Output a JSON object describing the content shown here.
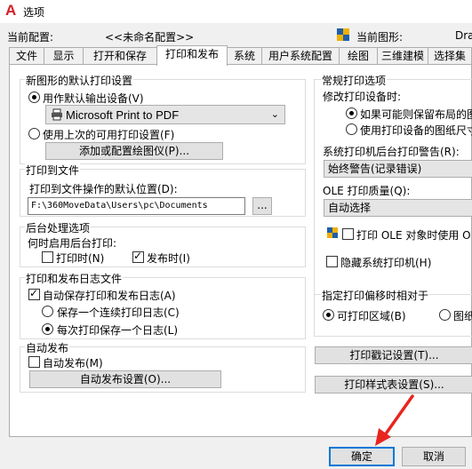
{
  "window": {
    "title": "选项"
  },
  "config": {
    "current_profile_label": "当前配置:",
    "current_profile_value": "<<未命名配置>>",
    "current_drawing_label": "当前图形:",
    "current_drawing_value": "Dra"
  },
  "tabs": [
    {
      "label": "文件"
    },
    {
      "label": "显示"
    },
    {
      "label": "打开和保存"
    },
    {
      "label": "打印和发布",
      "active": true
    },
    {
      "label": "系统"
    },
    {
      "label": "用户系统配置"
    },
    {
      "label": "绘图"
    },
    {
      "label": "三维建模"
    },
    {
      "label": "选择集"
    }
  ],
  "default_plot": {
    "title": "新图形的默认打印设置",
    "use_as_default_label": "用作默认输出设备(V)",
    "device_value": "Microsoft Print to PDF",
    "use_last_label": "使用上次的可用打印设置(F)",
    "add_plotter_button": "添加或配置绘图仪(P)..."
  },
  "plot_to_file": {
    "title": "打印到文件",
    "location_label": "打印到文件操作的默认位置(D):",
    "location_value": "F:\\360MoveData\\Users\\pc\\Documents",
    "browse_button": "..."
  },
  "background": {
    "title": "后台处理选项",
    "when_label": "何时启用后台打印:",
    "plotting_label": "打印时(N)",
    "publishing_label": "发布时(I)"
  },
  "log": {
    "title": "打印和发布日志文件",
    "auto_save_label": "自动保存打印和发布日志(A)",
    "continuous_label": "保存一个连续打印日志(C)",
    "per_plot_label": "每次打印保存一个日志(L)"
  },
  "autopublish": {
    "title": "自动发布",
    "auto_label": "自动发布(M)",
    "settings_button": "自动发布设置(O)..."
  },
  "general": {
    "title": "常规打印选项",
    "when_changing_label": "修改打印设备时:",
    "keep_size_label": "如果可能则保留布局的图",
    "use_device_size_label": "使用打印设备的图纸尺寸",
    "spool_alert_label": "系统打印机后台打印警告(R):",
    "spool_alert_value": "始终警告(记录错误)",
    "ole_quality_label": "OLE 打印质量(Q):",
    "ole_quality_value": "自动选择",
    "ole_plot_label": "打印 OLE 对象时使用 O",
    "hide_printers_label": "隐藏系统打印机(H)"
  },
  "offset": {
    "title": "指定打印偏移时相对于",
    "printable_label": "可打印区域(B)",
    "edge_label": "图纸"
  },
  "stamp_button": "打印戳记设置(T)...",
  "style_button": "打印样式表设置(S)...",
  "footer": {
    "ok": "确定",
    "cancel": "取消"
  },
  "colors": {
    "accent": "#0078d7",
    "arrow": "#e8251f",
    "brand": "#d21f27"
  }
}
